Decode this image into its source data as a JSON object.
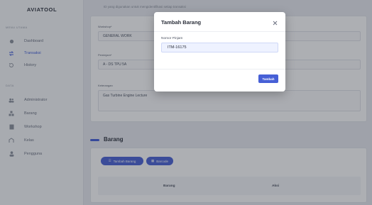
{
  "sidebar": {
    "brand": "AVIATOOL",
    "section_main": "MENU UTAMA",
    "section_data": "DATA",
    "items_main": [
      {
        "label": "Dashboard",
        "icon": "dashboard-icon"
      },
      {
        "label": "Transaksi",
        "icon": "transaction-icon"
      },
      {
        "label": "History",
        "icon": "history-icon"
      }
    ],
    "items_data": [
      {
        "label": "Administrator",
        "icon": "users-icon"
      },
      {
        "label": "Barang",
        "icon": "box-icon"
      },
      {
        "label": "Workshop",
        "icon": "building-icon"
      },
      {
        "label": "Kelas",
        "icon": "class-icon"
      },
      {
        "label": "Pengguna",
        "icon": "user-icon"
      }
    ]
  },
  "form": {
    "top_note": "ID yang digunakan untuk mengidentifikasi setiap transaksi",
    "workshop_label": "Workshop*",
    "workshop_value": "GENERAL WORK",
    "peminjam_label": "Peminjam*",
    "peminjam_value": "A - DS TPU 5A",
    "keterangan_label": "Keterangan",
    "keterangan_value": "Gas Turbine Engine Lecture"
  },
  "barang_section": {
    "title": "Barang",
    "add_button": "Tambah Barang",
    "barcode_button": "Barcode",
    "columns": [
      "Barang",
      "Aksi"
    ]
  },
  "modal": {
    "title": "Tambah Barang",
    "field_label": "Nomor Pinjam",
    "field_value": "ITM-16175",
    "submit": "Tambah"
  },
  "colors": {
    "accent": "#4760d6",
    "active_text": "#3f5bd8"
  }
}
